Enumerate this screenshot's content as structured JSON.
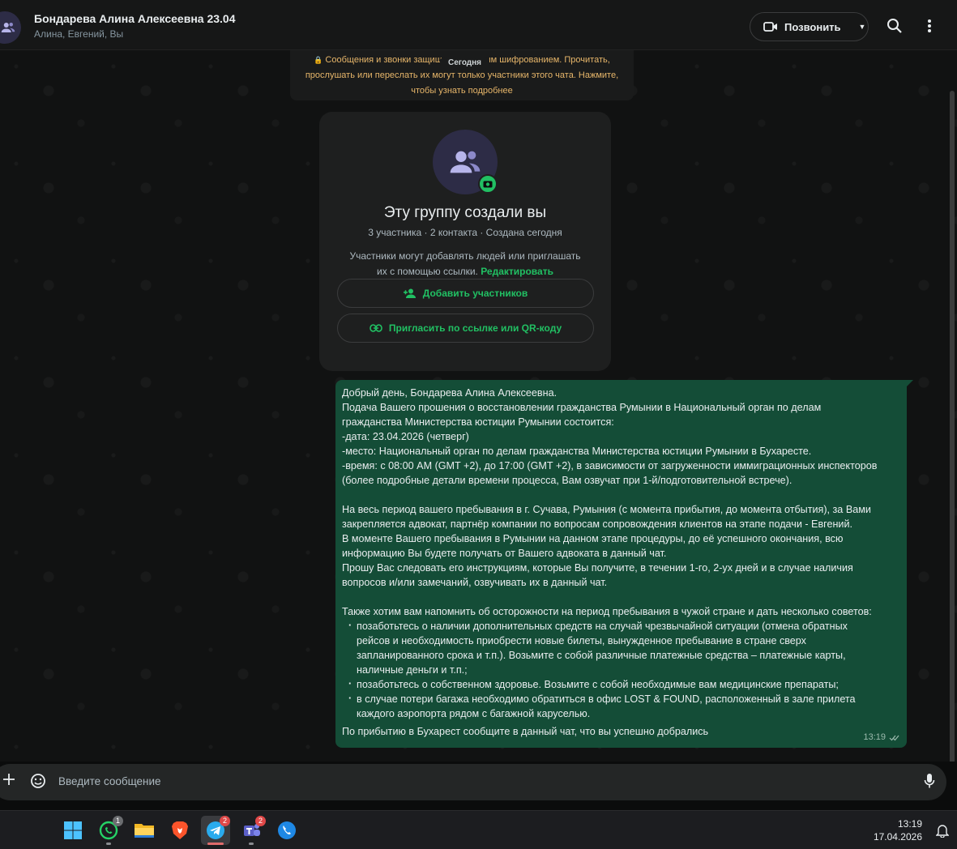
{
  "header": {
    "title": "Бондарева Алина Алексеевна 23.04",
    "subtitle": "Алина, Евгений, Вы",
    "call_label": "Позвонить",
    "icons": [
      "group-avatar-icon",
      "video-camera-icon",
      "chevron-down-icon",
      "search-icon",
      "more-vertical-icon"
    ]
  },
  "encryption_notice": {
    "line1_a": "Сообщения и звонки защищ",
    "line1_b": "ым шифрованием. Прочитать,",
    "line2": "прослушать или переслать их могут только участники этого чата. Нажмите,",
    "line3": "чтобы узнать подробнее"
  },
  "date_divider": "Сегодня",
  "group_card": {
    "title": "Эту группу создали вы",
    "meta": "3 участника · 2 контакта · Создана сегодня",
    "desc_line1": "Участники могут добавлять людей или приглашать",
    "desc_line2": "их с помощью ссылки.",
    "edit_link": "Редактировать",
    "add_members": "Добавить участников",
    "invite_link": "Пригласить по ссылке или QR-коду"
  },
  "message": {
    "lines": [
      "Добрый день, Бондарева Алина Алексеевна.",
      "Подача Вашего прошения о восстановлении гражданства Румынии в Национальный орган по делам",
      "гражданства Министерства юстиции Румынии состоится:",
      "-дата: 23.04.2026 (четверг)",
      "-место: Национальный орган по делам гражданства Министерства юстиции Румынии в Бухаресте.",
      "-время: с 08:00 AM (GMT +2), до 17:00 (GMT +2), в зависимости от загруженности иммиграционных инспекторов",
      "(более подробные детали времени процесса, Вам озвучат при 1-й/подготовительной встрече).",
      "",
      "На весь период вашего пребывания в г. Сучава, Румыния (с момента прибытия, до момента отбытия), за Вами",
      "закрепляется адвокат, партнёр компании по вопросам сопровождения клиентов на этапе подачи - Евгений.",
      "В моменте Вашего пребывания в Румынии на данном этапе процедуры, до её успешного окончания, всю",
      "информацию Вы будете получать от Вашего адвоката в данный чат.",
      "Прошу Вас следовать его инструкциям, которые Вы получите, в течении 1-го, 2-ух дней и в случае наличия",
      "вопросов и/или замечаний, озвучивать их в данный чат.",
      "",
      "Также хотим вам напомнить об осторожности на период пребывания в чужой стране и дать несколько советов:"
    ],
    "bullets": [
      {
        "lines": [
          "позаботьтесь о наличии дополнительных средств на случай чрезвычайной ситуации (отмена обратных",
          "рейсов и необходимость приобрести новые билеты, вынужденное пребывание в стране сверх",
          "запланированного срока и т.п.). Возьмите с собой различные платежные средства – платежные карты,",
          "наличные деньги и т.п.;"
        ]
      },
      {
        "lines": [
          "позаботьтесь о собственном здоровье. Возьмите с собой необходимые вам медицинские препараты;"
        ]
      },
      {
        "lines": [
          "в случае потери багажа необходимо обратиться в офис LOST & FOUND, расположенный в зале прилета",
          "каждого аэропорта рядом с багажной каруселью."
        ]
      }
    ],
    "closing": "По прибытию в Бухарест сообщите в данный чат, что вы успешно добрались",
    "time": "13:19",
    "status_icon": "double-check-icon"
  },
  "composer": {
    "placeholder": "Введите сообщение"
  },
  "taskbar": {
    "apps": [
      {
        "name": "windows-start-icon",
        "badge": ""
      },
      {
        "name": "whatsapp-icon",
        "badge": "1"
      },
      {
        "name": "file-explorer-icon",
        "badge": ""
      },
      {
        "name": "brave-browser-icon",
        "badge": ""
      },
      {
        "name": "telegram-icon",
        "badge": "2"
      },
      {
        "name": "teams-icon",
        "badge": "2"
      },
      {
        "name": "phone-app-icon",
        "badge": ""
      }
    ],
    "time": "13:19",
    "date": "17.04.2026"
  },
  "colors": {
    "accent": "#21c063",
    "bubble_out": "#144d37",
    "encryption_text": "#e7b66a",
    "panel": "#1e1f1f"
  }
}
